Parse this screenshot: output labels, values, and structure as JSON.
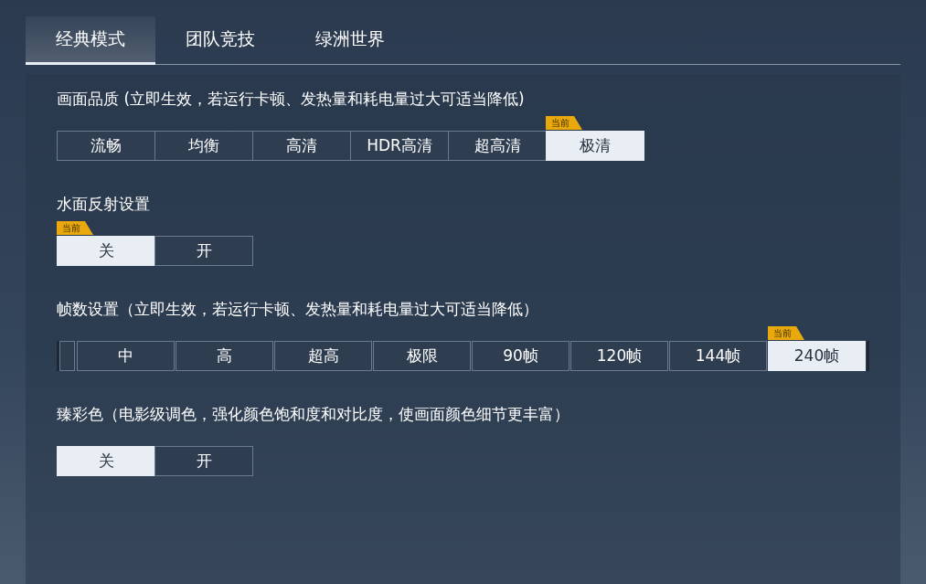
{
  "tabs": [
    {
      "label": "经典模式",
      "selected": true
    },
    {
      "label": "团队竞技",
      "selected": false
    },
    {
      "label": "绿洲世界",
      "selected": false
    }
  ],
  "sections": [
    {
      "kind": "segments",
      "title": "画面品质 (立即生效，若运行卡顿、发热量和耗电量过大可适当降低)",
      "options": [
        {
          "label": "流畅",
          "selected": false
        },
        {
          "label": "均衡",
          "selected": false
        },
        {
          "label": "高清",
          "selected": false
        },
        {
          "label": "HDR高清",
          "selected": false
        },
        {
          "label": "超高清",
          "selected": false
        },
        {
          "label": "极清",
          "selected": true,
          "badge": "当前"
        }
      ]
    },
    {
      "kind": "segments",
      "title": "水面反射设置",
      "options": [
        {
          "label": "关",
          "selected": true,
          "badge": "当前"
        },
        {
          "label": "开",
          "selected": false
        }
      ]
    },
    {
      "kind": "scroller",
      "title": "帧数设置（立即生效，若运行卡顿、发热量和耗电量过大可适当降低）",
      "options": [
        {
          "label": "中",
          "selected": false
        },
        {
          "label": "高",
          "selected": false
        },
        {
          "label": "超高",
          "selected": false
        },
        {
          "label": "极限",
          "selected": false
        },
        {
          "label": "90帧",
          "selected": false
        },
        {
          "label": "120帧",
          "selected": false
        },
        {
          "label": "144帧",
          "selected": false
        },
        {
          "label": "240帧",
          "selected": true,
          "badge": "当前"
        }
      ]
    },
    {
      "kind": "segments",
      "title": "臻彩色（电影级调色，强化颜色饱和度和对比度，使画面颜色细节更丰富）",
      "options": [
        {
          "label": "关",
          "selected": true
        },
        {
          "label": "开",
          "selected": false
        }
      ]
    }
  ]
}
